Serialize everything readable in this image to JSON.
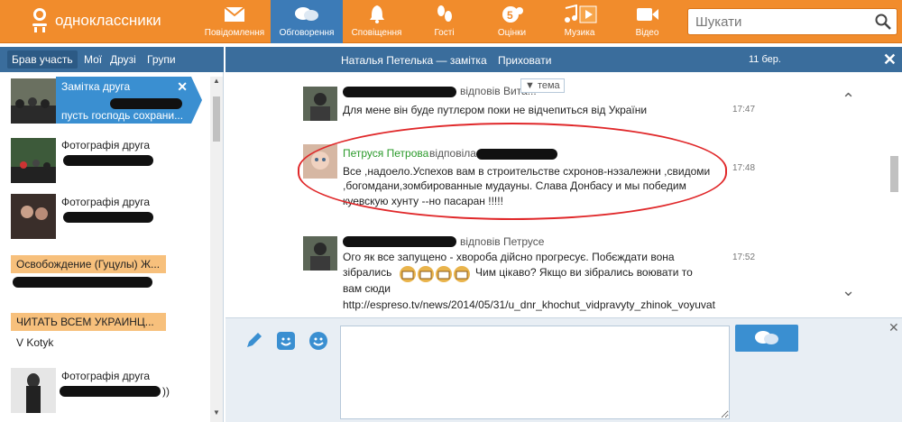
{
  "brand": {
    "name": "одноклассники",
    "accent": "#f18c2c",
    "active": "#3c7bb7"
  },
  "nav": [
    {
      "label": "Повідомлення",
      "icon": "envelope-icon"
    },
    {
      "label": "Обговорення",
      "icon": "discussions-icon",
      "active": true
    },
    {
      "label": "Сповіщення",
      "icon": "bell-icon"
    },
    {
      "label": "Гості",
      "icon": "footprints-icon"
    },
    {
      "label": "Оцінки",
      "icon": "ratings-icon"
    },
    {
      "label": "Музика",
      "icon": "music-icon"
    },
    {
      "label": "Відео",
      "icon": "video-icon"
    }
  ],
  "search": {
    "placeholder": "Шукати"
  },
  "tabs": {
    "active": "Брав участь",
    "t2": "Мої",
    "t3": "Друзі",
    "t4": "Групи"
  },
  "header": {
    "title": "Наталья Петелька — замітка",
    "hide": "Приховати",
    "date": "11 бер."
  },
  "left_items": [
    {
      "title": "Замітка друга",
      "sub": "пусть господь сохрани..."
    },
    {
      "title": "Фотографія друга"
    },
    {
      "title": "Фотографія друга"
    },
    {
      "title": "Освобождение (Гуцулы) Ж..."
    },
    {
      "title": "ЧИТАТЬ ВСЕМ УКРАИНЦ...",
      "sub": "V Kotyk"
    },
    {
      "title": "Фотографія друга",
      "sub": "))"
    }
  ],
  "tema": "▼ тема",
  "messages": [
    {
      "reply": "відповів Вита...",
      "text": "Для мене він буде путлєром поки не відчепиться від України",
      "time": "17:47"
    },
    {
      "author": "Петруся Петрова",
      "reply": "відповіла",
      "text1": "Все ,надоело.Успехов вам в строительстве схронов-нэзалежни ,свидоми",
      "text2": ",богомдани,зомбированные мудауны. Слава Донбасу и мы победим",
      "text3": "куевскую хунту --но пасаран !!!!!",
      "time": "17:48"
    },
    {
      "reply": "відповів Петрусе",
      "text1": "Ого як все запущено - хвороба дійсно прогресує. Побєждати вона",
      "text2a": "зібрались",
      "text2b": "Чим цікаво? Якщо ви зібрались воювати то",
      "text3": "вам сюди",
      "text4": "http://espreso.tv/news/2014/05/31/u_dnr_khochut_vidpravyty_zhinok_voyuvat",
      "time": "17:52"
    }
  ]
}
